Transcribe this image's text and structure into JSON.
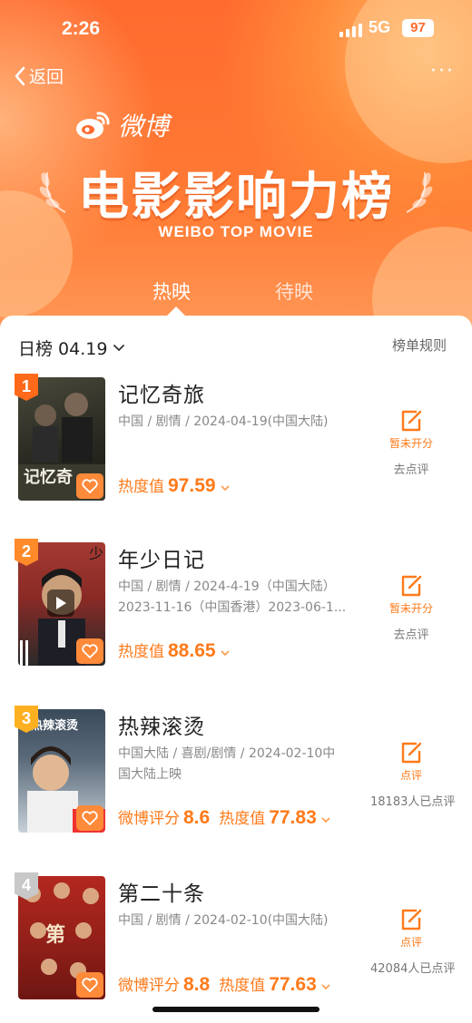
{
  "status": {
    "time": "2:26",
    "network": "5G",
    "battery": "97"
  },
  "nav": {
    "back_label": "返回",
    "more_label": "···"
  },
  "brand": {
    "logo_text": "微博",
    "title": "电影影响力榜",
    "subtitle": "WEIBO TOP MOVIE"
  },
  "tabs": [
    {
      "label": "热映",
      "active": true
    },
    {
      "label": "待映",
      "active": false
    }
  ],
  "list_header": {
    "day_label": "日榜 04.19",
    "rules_label": "榜单规则"
  },
  "movies": [
    {
      "rank": "1",
      "title": "记忆奇旅",
      "info_line1": "中国 / 剧情 / 2024-04-19(中国大陆)",
      "info_line2": "",
      "score_label": "",
      "score": "",
      "heat_label": "热度值",
      "heat": "97.59",
      "rate_label": "暂未开分",
      "rate_sub": "去点评",
      "rank_color": "#ff6a1a"
    },
    {
      "rank": "2",
      "title": "年少日记",
      "info_line1": "中国 / 剧情 / 2024-4-19（中国大陆）",
      "info_line2": "2023-11-16（中国香港）2023-06-1...",
      "score_label": "",
      "score": "",
      "heat_label": "热度值",
      "heat": "88.65",
      "rate_label": "暂未开分",
      "rate_sub": "去点评",
      "rank_color": "#ff8a2a"
    },
    {
      "rank": "3",
      "title": "热辣滚烫",
      "info_line1": "中国大陆 / 喜剧/剧情 / 2024-02-10中",
      "info_line2": "国大陆上映",
      "score_label": "微博评分",
      "score": "8.6",
      "heat_label": "热度值",
      "heat": "77.83",
      "rate_label": "点评",
      "rate_sub": "18183人已点评",
      "rank_color": "#ffb020"
    },
    {
      "rank": "4",
      "title": "第二十条",
      "info_line1": "中国 / 剧情 / 2024-02-10(中国大陆)",
      "info_line2": "",
      "score_label": "微博评分",
      "score": "8.8",
      "heat_label": "热度值",
      "heat": "77.63",
      "rate_label": "点评",
      "rate_sub": "42084人已点评",
      "rank_color": "#c8c8c8"
    }
  ],
  "colors": {
    "accent": "#ff7a1a",
    "header": "#ff6a2e"
  }
}
